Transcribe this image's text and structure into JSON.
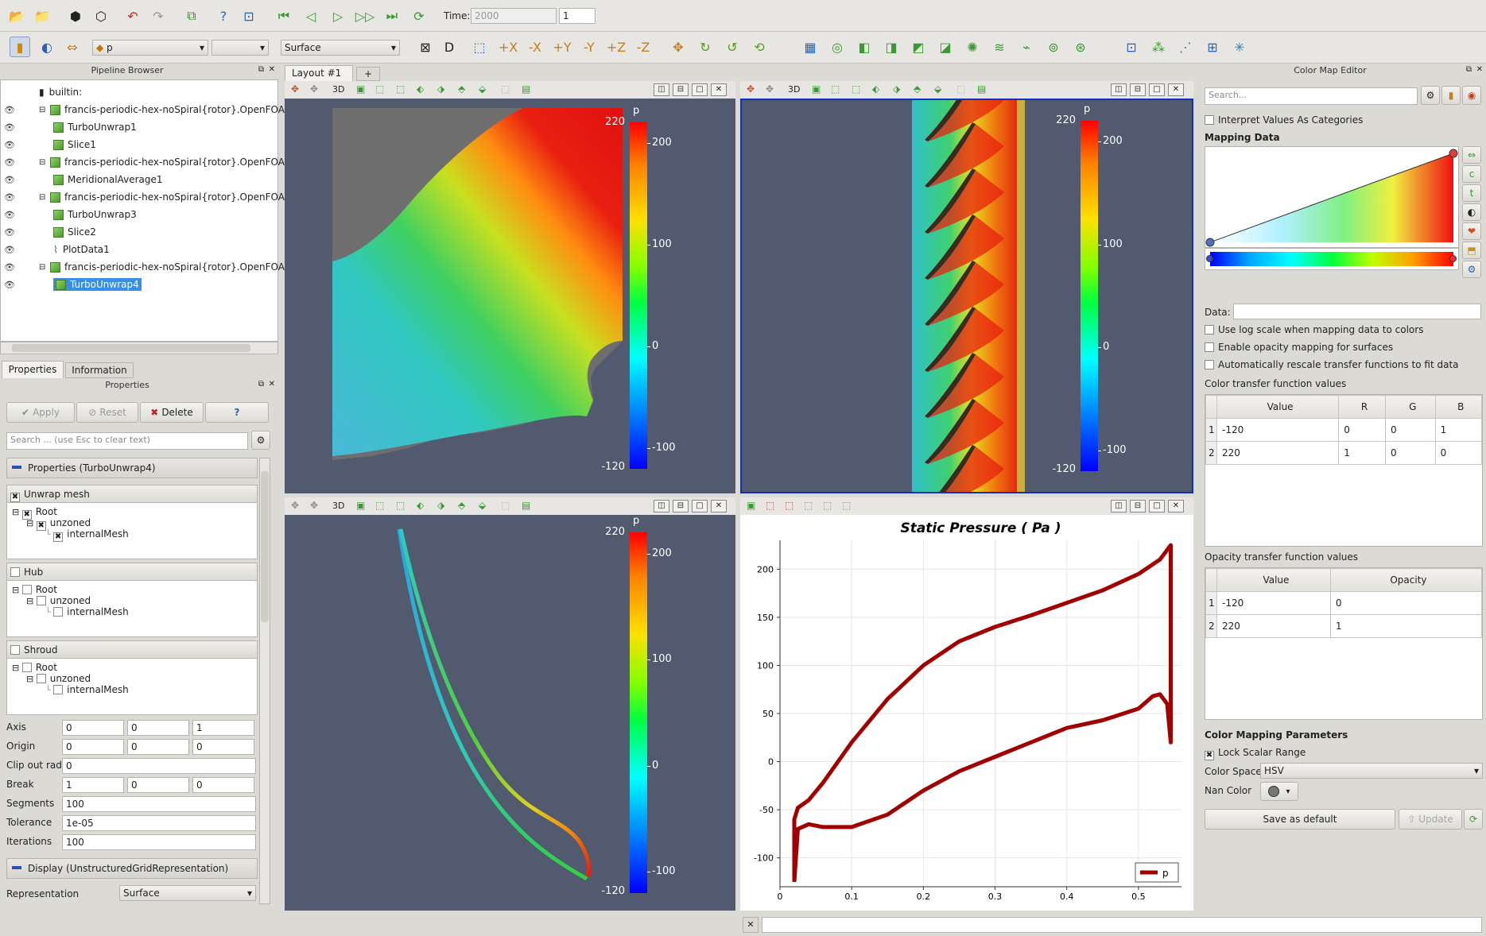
{
  "toolbar_top": {
    "time_label": "Time:",
    "time_value": "2000",
    "time_index": "1",
    "icons": [
      "open-file",
      "load-state",
      "save-state",
      "connect",
      "undo",
      "redo",
      "find-data",
      "help",
      "camera-link",
      "first-frame",
      "prev-frame",
      "play",
      "next-frame",
      "last-frame",
      "loop"
    ]
  },
  "toolbar_second": {
    "array_select": "p",
    "component_select": "",
    "representation_select": "Surface"
  },
  "pipeline_browser": {
    "title": "Pipeline Browser",
    "items": [
      {
        "label": "builtin:",
        "level": 0,
        "type": "server",
        "eye": false
      },
      {
        "label": "francis-periodic-hex-noSpiral{rotor}.OpenFOAM",
        "level": 1,
        "type": "source",
        "eye": true
      },
      {
        "label": "TurboUnwrap1",
        "level": 2,
        "type": "filter",
        "eye": true
      },
      {
        "label": "Slice1",
        "level": 2,
        "type": "filter",
        "eye": true
      },
      {
        "label": "francis-periodic-hex-noSpiral{rotor}.OpenFOAM",
        "level": 1,
        "type": "source",
        "eye": true
      },
      {
        "label": "MeridionalAverage1",
        "level": 2,
        "type": "filter",
        "eye": true
      },
      {
        "label": "francis-periodic-hex-noSpiral{rotor}.OpenFOAM",
        "level": 1,
        "type": "source",
        "eye": true
      },
      {
        "label": "TurboUnwrap3",
        "level": 2,
        "type": "filter",
        "eye": true
      },
      {
        "label": "Slice2",
        "level": 2,
        "type": "filter",
        "eye": true
      },
      {
        "label": "PlotData1",
        "level": 2,
        "type": "plot",
        "eye": true
      },
      {
        "label": "francis-periodic-hex-noSpiral{rotor}.OpenFOAM",
        "level": 1,
        "type": "source",
        "eye": true
      },
      {
        "label": "TurboUnwrap4",
        "level": 2,
        "type": "filter",
        "eye": true,
        "selected": true
      }
    ]
  },
  "left_tabs": [
    "Properties",
    "Information"
  ],
  "properties": {
    "title": "Properties",
    "apply": "Apply",
    "reset": "Reset",
    "delete": "Delete",
    "help": "?",
    "search_placeholder": "Search ... (use Esc to clear text)",
    "section_title": "Properties (TurboUnwrap4)",
    "groups": [
      {
        "name": "Unwrap mesh",
        "checked": true,
        "root": "Root",
        "zone": "unzoned",
        "mesh": "internalMesh",
        "mesh_checked": true
      },
      {
        "name": "Hub",
        "checked": false,
        "root": "Root",
        "zone": "unzoned",
        "mesh": "internalMesh",
        "mesh_checked": false
      },
      {
        "name": "Shroud",
        "checked": false,
        "root": "Root",
        "zone": "unzoned",
        "mesh": "internalMesh",
        "mesh_checked": false
      }
    ],
    "fields": [
      {
        "label": "Axis",
        "values": [
          "0",
          "0",
          "1"
        ]
      },
      {
        "label": "Origin",
        "values": [
          "0",
          "0",
          "0"
        ]
      },
      {
        "label": "Clip out radius",
        "values": [
          "0"
        ]
      },
      {
        "label": "Break",
        "values": [
          "1",
          "0",
          "0"
        ]
      },
      {
        "label": "Segments",
        "values": [
          "100"
        ]
      },
      {
        "label": "Tolerance",
        "values": [
          "1e-05"
        ]
      },
      {
        "label": "Iterations",
        "values": [
          "100"
        ]
      }
    ],
    "display_section": "Display (UnstructuredGridRepresentation)",
    "representation_label": "Representation",
    "representation_value": "Surface"
  },
  "layout": {
    "tab": "Layout #1",
    "add_tab": "+",
    "view_3d_label": "3D"
  },
  "colorbar": {
    "title": "p",
    "max": "220",
    "min": "-120",
    "ticks": [
      "200",
      "100",
      "0",
      "-100"
    ]
  },
  "chart_data": {
    "type": "line",
    "title": "Static Pressure ( Pa )",
    "xlabel": "",
    "ylabel": "",
    "xlim": [
      0,
      0.56
    ],
    "ylim": [
      -130,
      230
    ],
    "xticks": [
      "0",
      "0.1",
      "0.2",
      "0.3",
      "0.4",
      "0.5"
    ],
    "yticks": [
      "-100",
      "-50",
      "0",
      "50",
      "100",
      "150",
      "200"
    ],
    "grid": true,
    "legend": {
      "position": "bottom-right",
      "entries": [
        "p"
      ]
    },
    "series": [
      {
        "name": "p",
        "color": "#a00000",
        "x": [
          0.02,
          0.02,
          0.025,
          0.04,
          0.06,
          0.1,
          0.15,
          0.2,
          0.25,
          0.3,
          0.35,
          0.4,
          0.45,
          0.5,
          0.53,
          0.545,
          0.545,
          0.54,
          0.53,
          0.52,
          0.5,
          0.45,
          0.4,
          0.35,
          0.3,
          0.25,
          0.2,
          0.15,
          0.1,
          0.06,
          0.04,
          0.025,
          0.02
        ],
        "y": [
          -125,
          -60,
          -48,
          -40,
          -22,
          20,
          65,
          100,
          125,
          140,
          152,
          165,
          178,
          195,
          210,
          225,
          20,
          60,
          70,
          68,
          55,
          43,
          35,
          20,
          5,
          -10,
          -30,
          -55,
          -68,
          -68,
          -65,
          -70,
          -125
        ]
      }
    ]
  },
  "color_map_editor": {
    "title": "Color Map Editor",
    "search_placeholder": "Search...",
    "interpret_categories": "Interpret Values As Categories",
    "mapping_data": "Mapping Data",
    "data_label": "Data:",
    "log_scale": "Use log scale when mapping data to colors",
    "opacity_mapping": "Enable opacity mapping for surfaces",
    "auto_rescale": "Automatically rescale transfer functions to fit data",
    "ctf_title": "Color transfer function values",
    "ctf_headers": [
      "Value",
      "R",
      "G",
      "B"
    ],
    "ctf_rows": [
      [
        "1",
        "-120",
        "0",
        "0",
        "1"
      ],
      [
        "2",
        "220",
        "1",
        "0",
        "0"
      ]
    ],
    "otf_title": "Opacity transfer function values",
    "otf_headers": [
      "Value",
      "Opacity"
    ],
    "otf_rows": [
      [
        "1",
        "-120",
        "0"
      ],
      [
        "2",
        "220",
        "1"
      ]
    ],
    "params_title": "Color Mapping Parameters",
    "lock_scalar": "Lock Scalar Range",
    "color_space_label": "Color Space",
    "color_space_value": "HSV",
    "nan_color_label": "Nan Color",
    "save_default": "Save as default",
    "update": "Update"
  }
}
